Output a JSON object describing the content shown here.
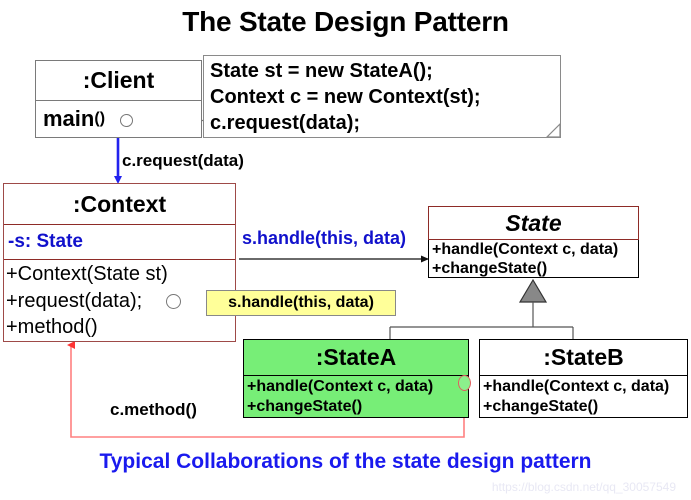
{
  "title": "The State Design Pattern",
  "caption": "Typical Collaborations of the state design pattern",
  "watermark": "https://blog.csdn.net/qq_30057549",
  "colors": {
    "title_text": "#000000",
    "caption_text": "#1a1aee",
    "context_border": "#8e2b27",
    "state_header_border": "#8e2b27",
    "statea_fill": "#77ee77",
    "note_fill": "#ffff99",
    "attribute_text": "#1111cc",
    "message_text": "#1111cc",
    "callback_line": "#ff6666",
    "call_arrow": "#2222ee"
  },
  "classes": {
    "client": {
      "name": ":Client",
      "operations": [
        "main",
        "()"
      ]
    },
    "context": {
      "name": ":Context",
      "attribute": "-s: State",
      "operations": [
        "+Context(State st)",
        "+request(data);",
        "+method()"
      ]
    },
    "state": {
      "name": "State",
      "stereotype": "abstract",
      "operations": [
        "+handle(Context c, data)",
        "+changeState()"
      ]
    },
    "state_a": {
      "name": ":StateA",
      "operations": [
        "+handle(Context c, data)",
        "+changeState()"
      ]
    },
    "state_b": {
      "name": ":StateB",
      "operations": [
        "+handle(Context c, data)",
        "+changeState()"
      ]
    }
  },
  "notes": {
    "code_note": [
      "State st = new StateA();",
      "Context c = new Context(st);",
      "c.request(data);"
    ],
    "yellow_note": "s.handle(this, data)"
  },
  "messages": {
    "client_to_context": "c.request(data)",
    "context_to_state": "s.handle(this, data)",
    "statea_to_context": "c.method()"
  }
}
